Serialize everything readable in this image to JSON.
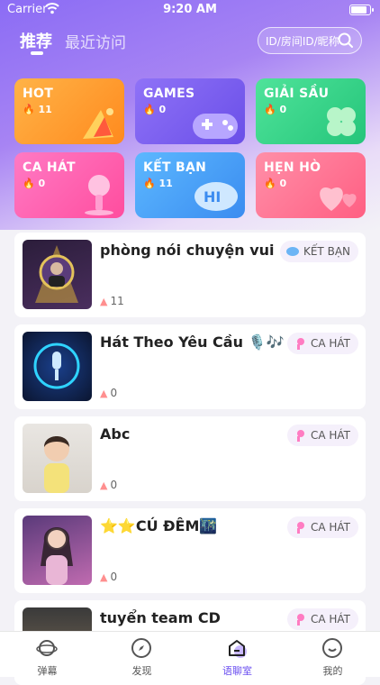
{
  "status_bar": {
    "carrier": "Carrier",
    "time": "9:20 AM"
  },
  "header": {
    "tabs": [
      {
        "label": "推荐",
        "active": true
      },
      {
        "label": "最近访问",
        "active": false
      }
    ],
    "search_placeholder": "ID/房间ID/昵称"
  },
  "categories": [
    {
      "label": "HOT",
      "count": "11",
      "color": "#ffa32a"
    },
    {
      "label": "GAMES",
      "count": "0",
      "color": "#7a5cf2"
    },
    {
      "label": "GIẢI SẦU",
      "count": "0",
      "color": "#3fd98a"
    },
    {
      "label": "CA HÁT",
      "count": "0",
      "color": "#ff5fb0"
    },
    {
      "label": "KẾT BẠN",
      "count": "11",
      "color": "#4aa6f5"
    },
    {
      "label": "HẸN HÒ",
      "count": "0",
      "color": "#ff6a8f"
    }
  ],
  "rooms": [
    {
      "title": "phòng nói chuyện vui",
      "count": "11",
      "tag": "KẾT BẠN"
    },
    {
      "title": "Hát Theo Yêu Cầu 🎙️🎶",
      "count": "0",
      "tag": "CA HÁT"
    },
    {
      "title": "Abc",
      "count": "0",
      "tag": "CA HÁT"
    },
    {
      "title": "⭐⭐CÚ ĐÊM🌃",
      "count": "0",
      "tag": "CA HÁT"
    },
    {
      "title": "tuyển team CD",
      "count": "",
      "tag": "CA HÁT"
    }
  ],
  "tab_bar": {
    "items": [
      {
        "label": "弹幕",
        "icon": "planet-icon"
      },
      {
        "label": "发现",
        "icon": "compass-icon"
      },
      {
        "label": "语聊室",
        "icon": "home-icon",
        "active": true
      },
      {
        "label": "我的",
        "icon": "smile-icon"
      }
    ]
  }
}
